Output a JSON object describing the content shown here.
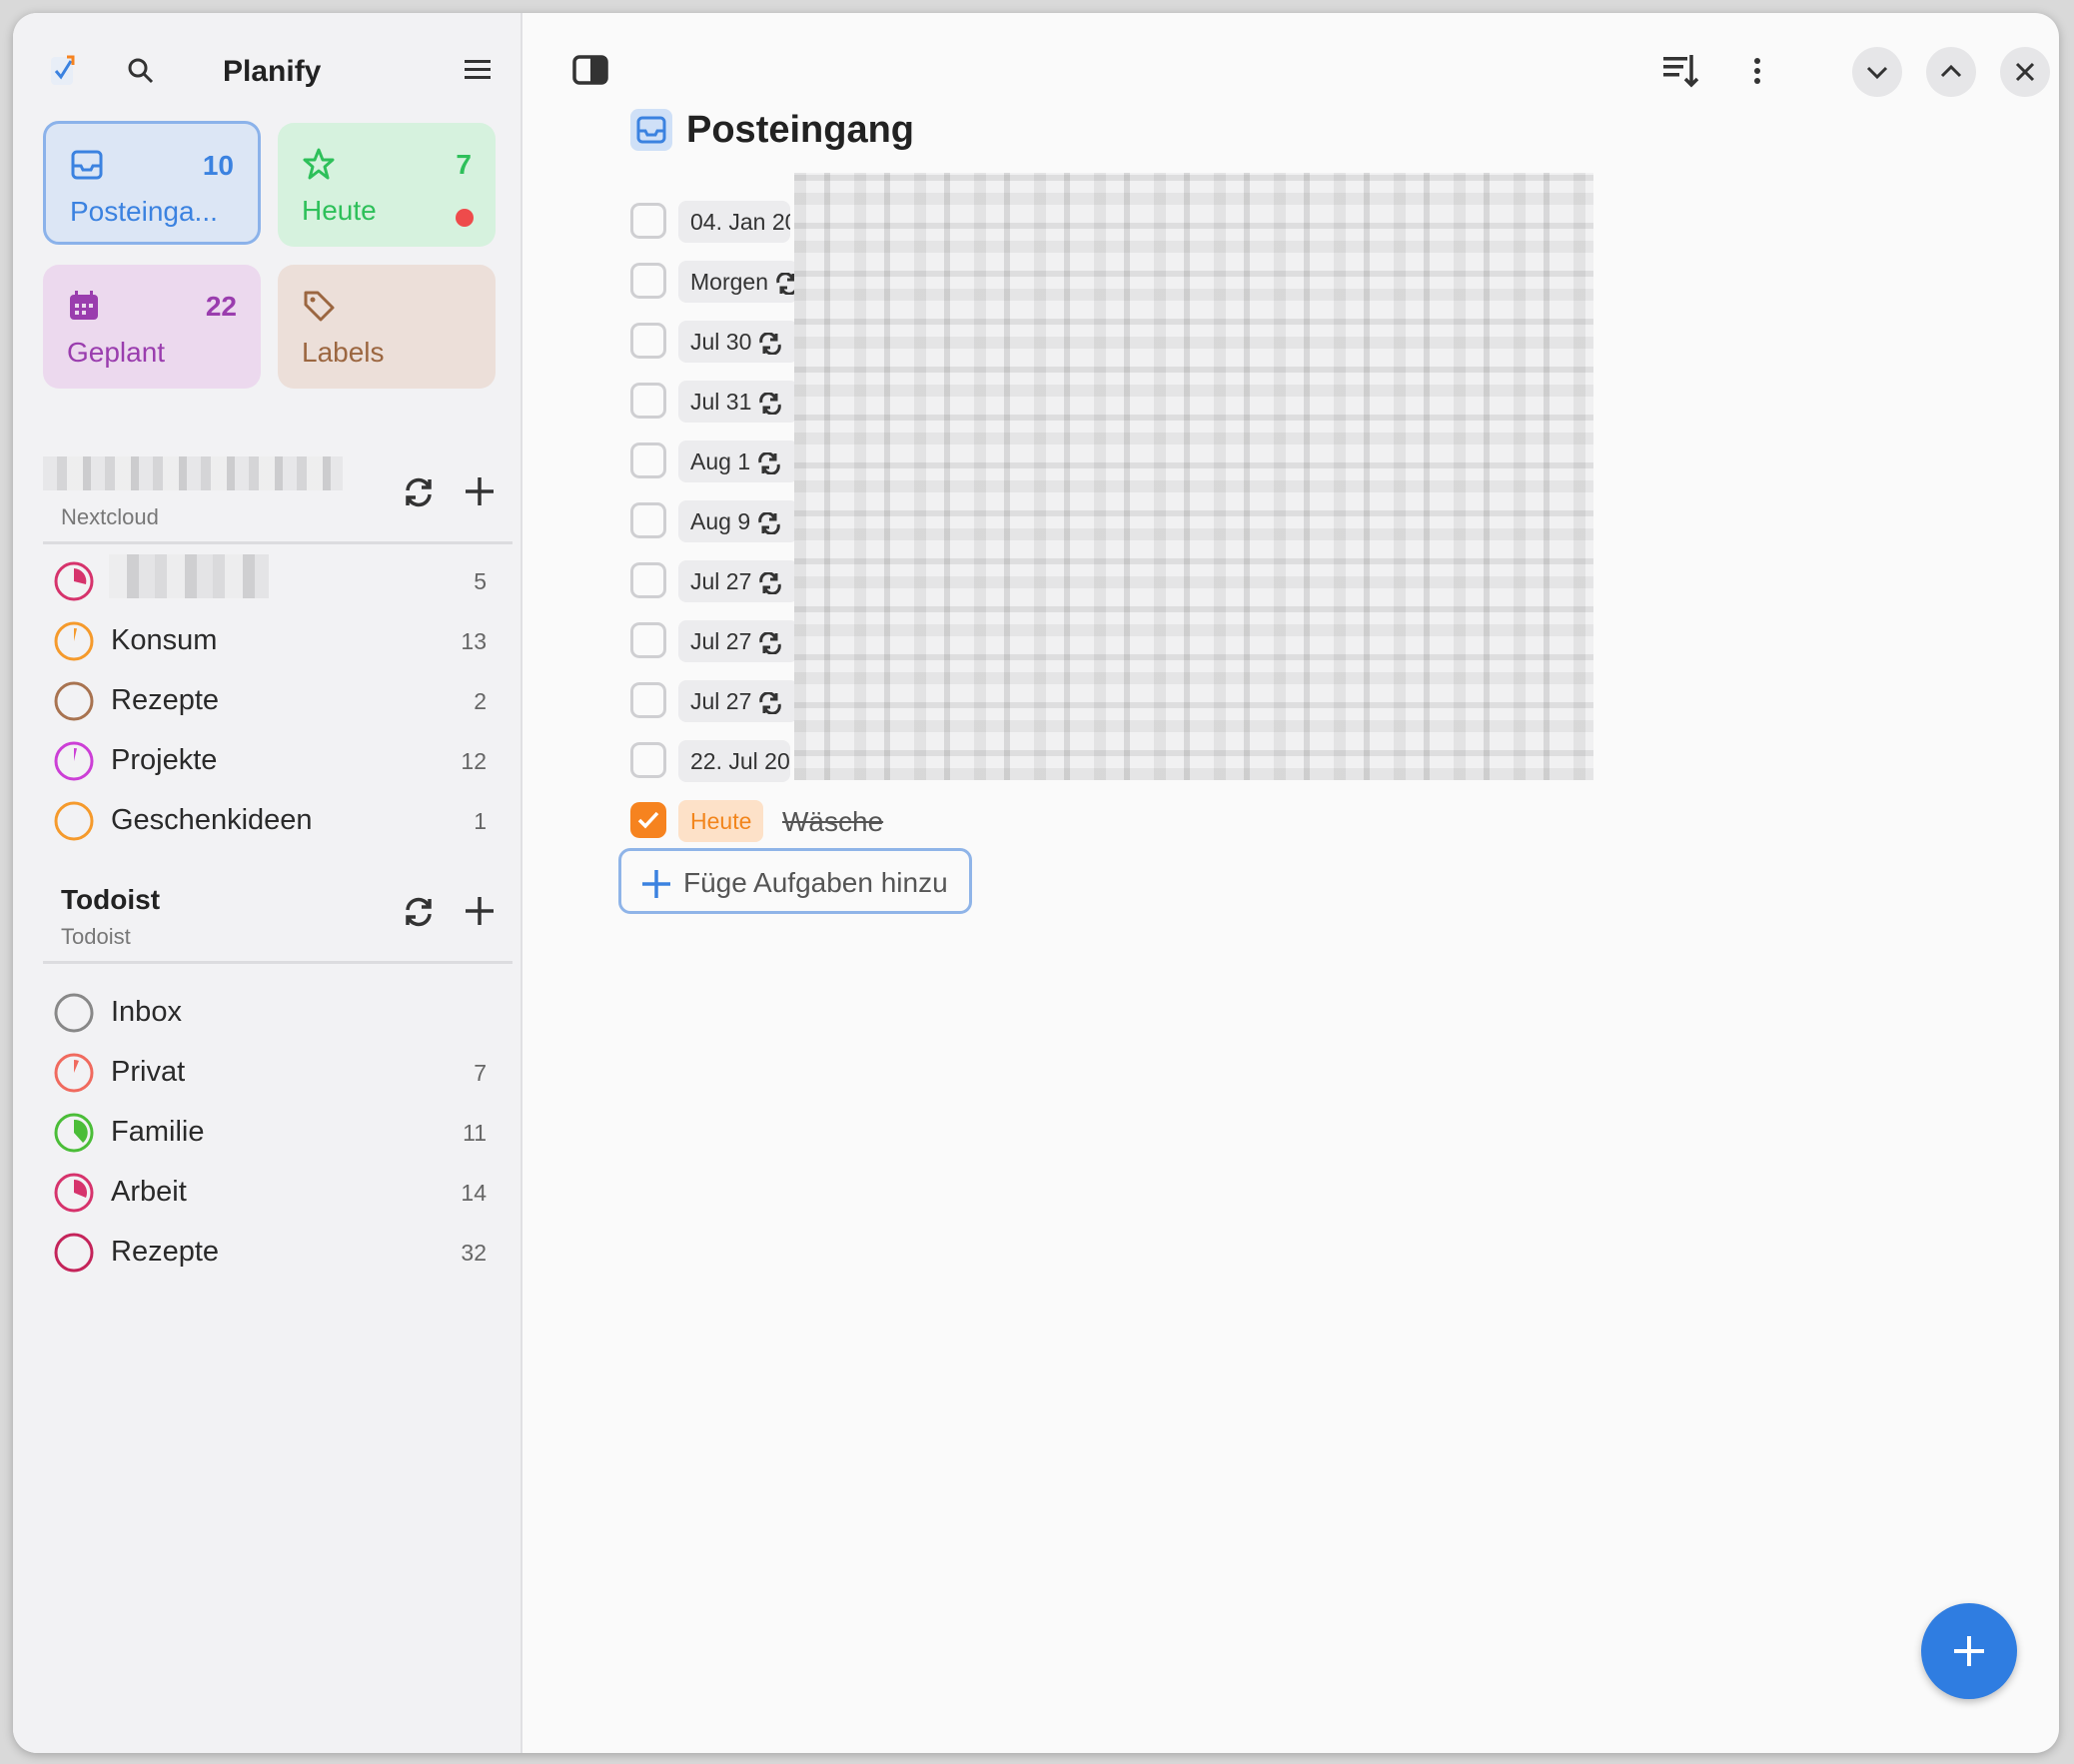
{
  "app": {
    "title": "Planify"
  },
  "tiles": {
    "inbox": {
      "label": "Posteinga...",
      "count": "10"
    },
    "today": {
      "label": "Heute",
      "count": "7"
    },
    "scheduled": {
      "label": "Geplant",
      "count": "22"
    },
    "labels": {
      "label": "Labels"
    }
  },
  "sources": [
    {
      "name": "",
      "subtitle": "Nextcloud",
      "projects": [
        {
          "name": "",
          "count": "5",
          "color": "#d6336c"
        },
        {
          "name": "Konsum",
          "count": "13",
          "color": "#f59a2c"
        },
        {
          "name": "Rezepte",
          "count": "2",
          "color": "#a87350"
        },
        {
          "name": "Projekte",
          "count": "12",
          "color": "#cc3fd6"
        },
        {
          "name": "Geschenkideen",
          "count": "1",
          "color": "#f59a2c"
        }
      ]
    },
    {
      "name": "Todoist",
      "subtitle": "Todoist",
      "projects": [
        {
          "name": "Inbox",
          "count": "",
          "color": "#888888"
        },
        {
          "name": "Privat",
          "count": "7",
          "color": "#f06a5e"
        },
        {
          "name": "Familie",
          "count": "11",
          "color": "#4bbd38"
        },
        {
          "name": "Arbeit",
          "count": "14",
          "color": "#d6336c"
        },
        {
          "name": "Rezepte",
          "count": "32",
          "color": "#c4245a"
        }
      ]
    }
  ],
  "main": {
    "title": "Posteingang",
    "tasks": [
      {
        "date": "04. Jan 20",
        "repeat": false
      },
      {
        "date": "Morgen",
        "repeat": true
      },
      {
        "date": "Jul 30",
        "repeat": true
      },
      {
        "date": "Jul 31",
        "repeat": true
      },
      {
        "date": "Aug 1",
        "repeat": true
      },
      {
        "date": "Aug 9",
        "repeat": true
      },
      {
        "date": "Jul 27",
        "repeat": true
      },
      {
        "date": "Jul 27",
        "repeat": true
      },
      {
        "date": "Jul 27",
        "repeat": true
      },
      {
        "date": "22. Jul 202",
        "repeat": false
      }
    ],
    "completed_task": {
      "date": "Heute",
      "name": "Wäsche"
    },
    "add_task_label": "Füge Aufgaben hinzu"
  },
  "colors": {
    "accent": "#2f7de1",
    "inbox": "#3b82e0",
    "today": "#2ec05a",
    "scheduled": "#9a3dae",
    "labels": "#9b6640",
    "done": "#f6831f"
  }
}
